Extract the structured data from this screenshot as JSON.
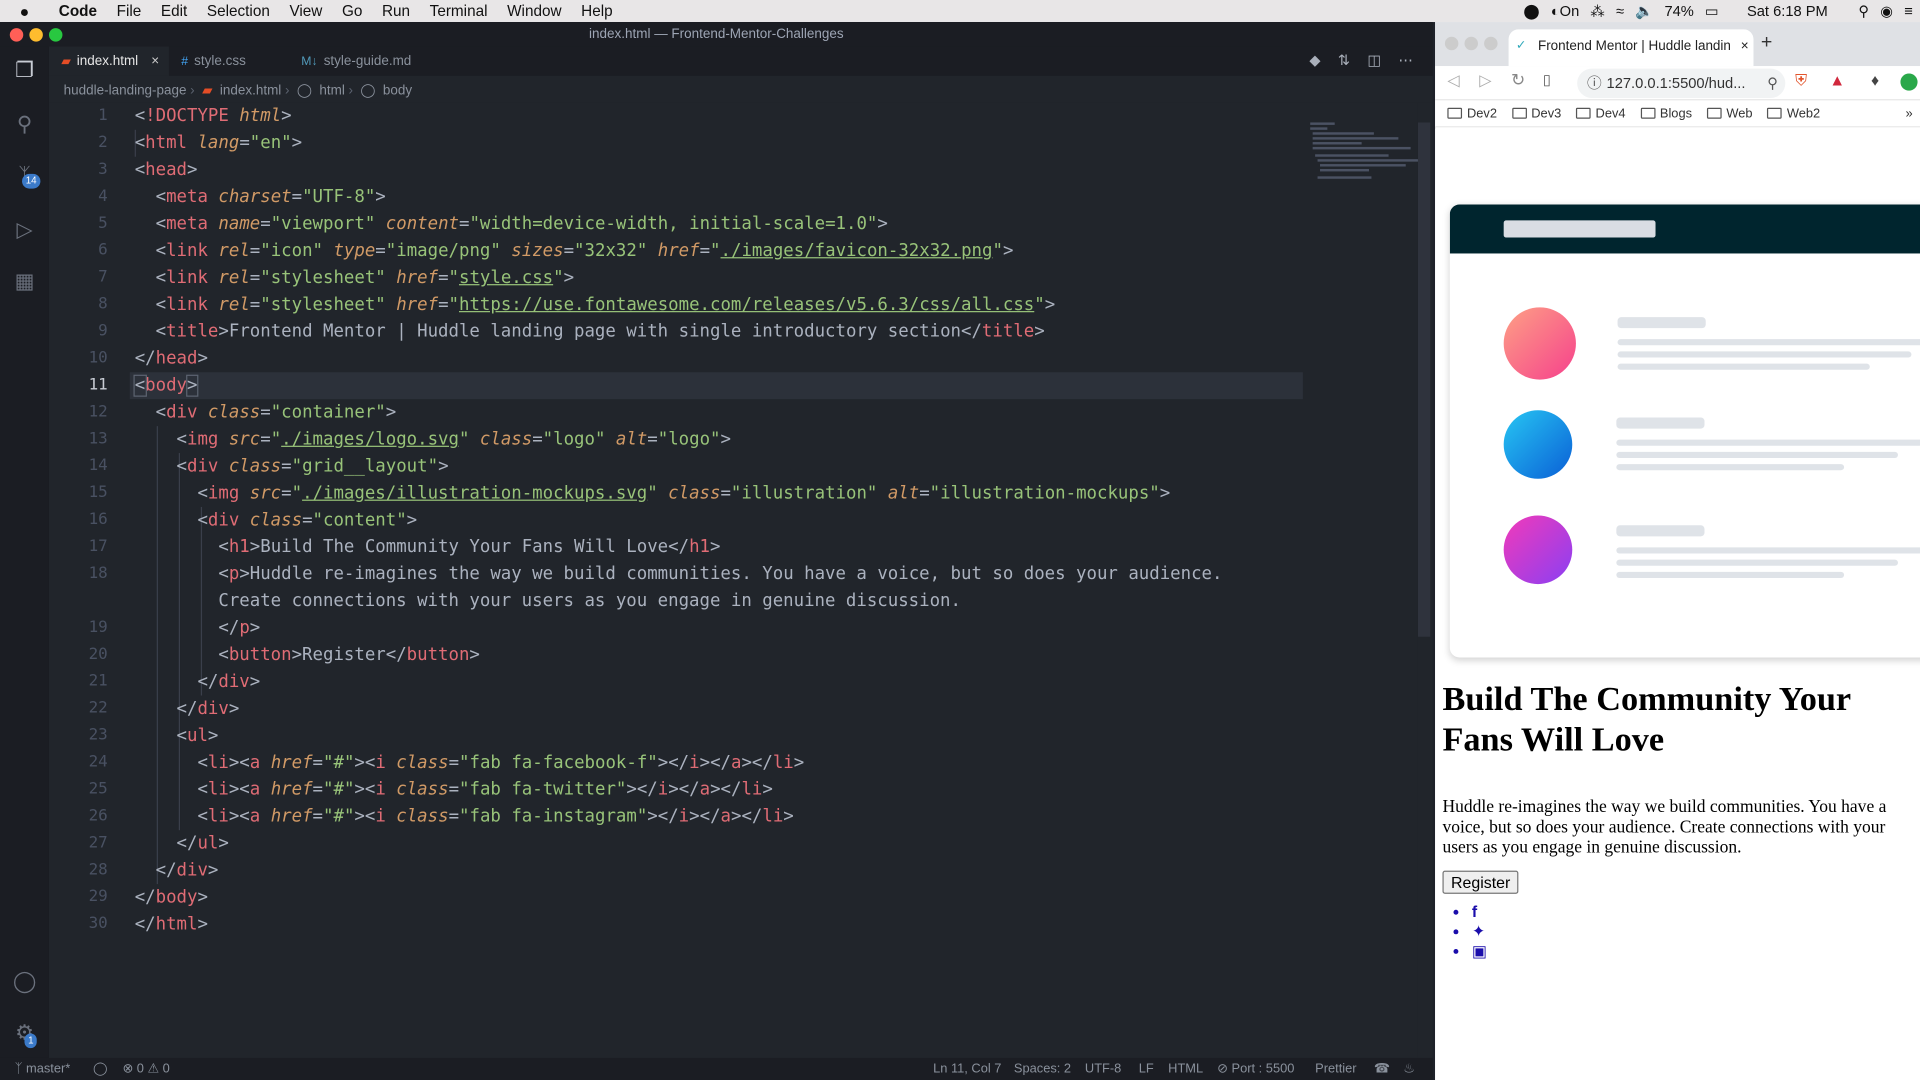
{
  "menubar": {
    "apple": "",
    "items": [
      "Code",
      "File",
      "Edit",
      "Selection",
      "View",
      "Go",
      "Run",
      "Terminal",
      "Window",
      "Help"
    ],
    "status_on": "On",
    "battery": "74%",
    "clock": "Sat 6:18 PM"
  },
  "vscode": {
    "window_title": "index.html — Frontend-Mentor-Challenges",
    "scm_badge": "14",
    "settings_badge": "1",
    "tabs": [
      {
        "label": "index.html",
        "icon": "html-file-icon",
        "active": true,
        "close": "×"
      },
      {
        "label": "style.css",
        "icon": "css-file-icon",
        "active": false
      },
      {
        "label": "style-guide.md",
        "icon": "markdown-file-icon",
        "active": false
      }
    ],
    "breadcrumb": [
      "huddle-landing-page",
      "index.html",
      "html",
      "body"
    ],
    "status": {
      "branch": "master*",
      "problems": "⊗ 0 ⚠ 0",
      "position": "Ln 11, Col 7",
      "spaces": "Spaces: 2",
      "encoding": "UTF-8",
      "eol": "LF",
      "language": "HTML",
      "port": "⊘ Port : 5500",
      "formatter": "Prettier"
    },
    "line_numbers": [
      "1",
      "2",
      "3",
      "4",
      "5",
      "6",
      "7",
      "8",
      "9",
      "10",
      "11",
      "12",
      "13",
      "14",
      "15",
      "16",
      "17",
      "18",
      "",
      "19",
      "20",
      "21",
      "22",
      "23",
      "24",
      "25",
      "26",
      "27",
      "28",
      "29",
      "30"
    ]
  },
  "browser": {
    "tab_title": "Frontend Mentor | Huddle landin",
    "url": "127.0.0.1:5500/hud...",
    "bookmarks": [
      "Dev2",
      "Dev3",
      "Dev4",
      "Blogs",
      "Web",
      "Web2"
    ],
    "page": {
      "heading": "Build The Community Your Fans Will Love",
      "paragraph": "Huddle re-imagines the way we build communities. You have a voice, but so does your audience. Create connections with your users as you engage in genuine discussion.",
      "button": "Register"
    }
  },
  "colors": {
    "editor_bg": "#21252b",
    "tag": "#e06c75",
    "attr": "#d19a66",
    "string": "#98c379",
    "mock_header": "#00252e"
  }
}
